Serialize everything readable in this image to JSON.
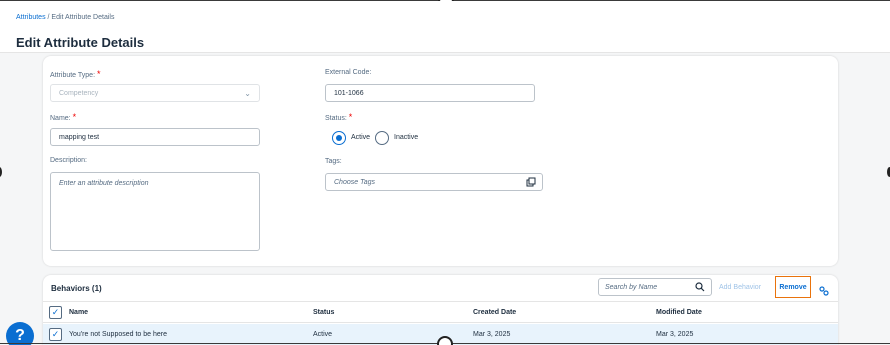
{
  "breadcrumb": {
    "link": "Attributes",
    "separator": " / ",
    "current": "Edit Attribute Details"
  },
  "page_title": "Edit Attribute Details",
  "form": {
    "attribute_type": {
      "label": "Attribute Type:",
      "required_mark": "*",
      "value": "Competency"
    },
    "name": {
      "label": "Name:",
      "required_mark": "*",
      "value": "mapping test"
    },
    "description": {
      "label": "Description:",
      "placeholder": "Enter an attribute description"
    },
    "external_code": {
      "label": "External Code:",
      "value": "101-1066"
    },
    "status": {
      "label": "Status:",
      "required_mark": "*",
      "options": [
        "Active",
        "Inactive"
      ],
      "selected": "Active"
    },
    "tags": {
      "label": "Tags:",
      "placeholder": "Choose Tags"
    }
  },
  "behaviors": {
    "title": "Behaviors (1)",
    "search_placeholder": "Search by Name",
    "add_label": "Add Behavior",
    "remove_label": "Remove",
    "columns": [
      "Name",
      "Status",
      "Created Date",
      "Modified Date"
    ],
    "rows": [
      {
        "name": "You're not Supposed to be here",
        "status": "Active",
        "created": "Mar 3, 2025",
        "modified": "Mar 3, 2025"
      }
    ]
  },
  "help_label": "?",
  "colors": {
    "accent": "#0a6ed1",
    "required": "#ee0000",
    "highlight_border": "#e9730c"
  }
}
